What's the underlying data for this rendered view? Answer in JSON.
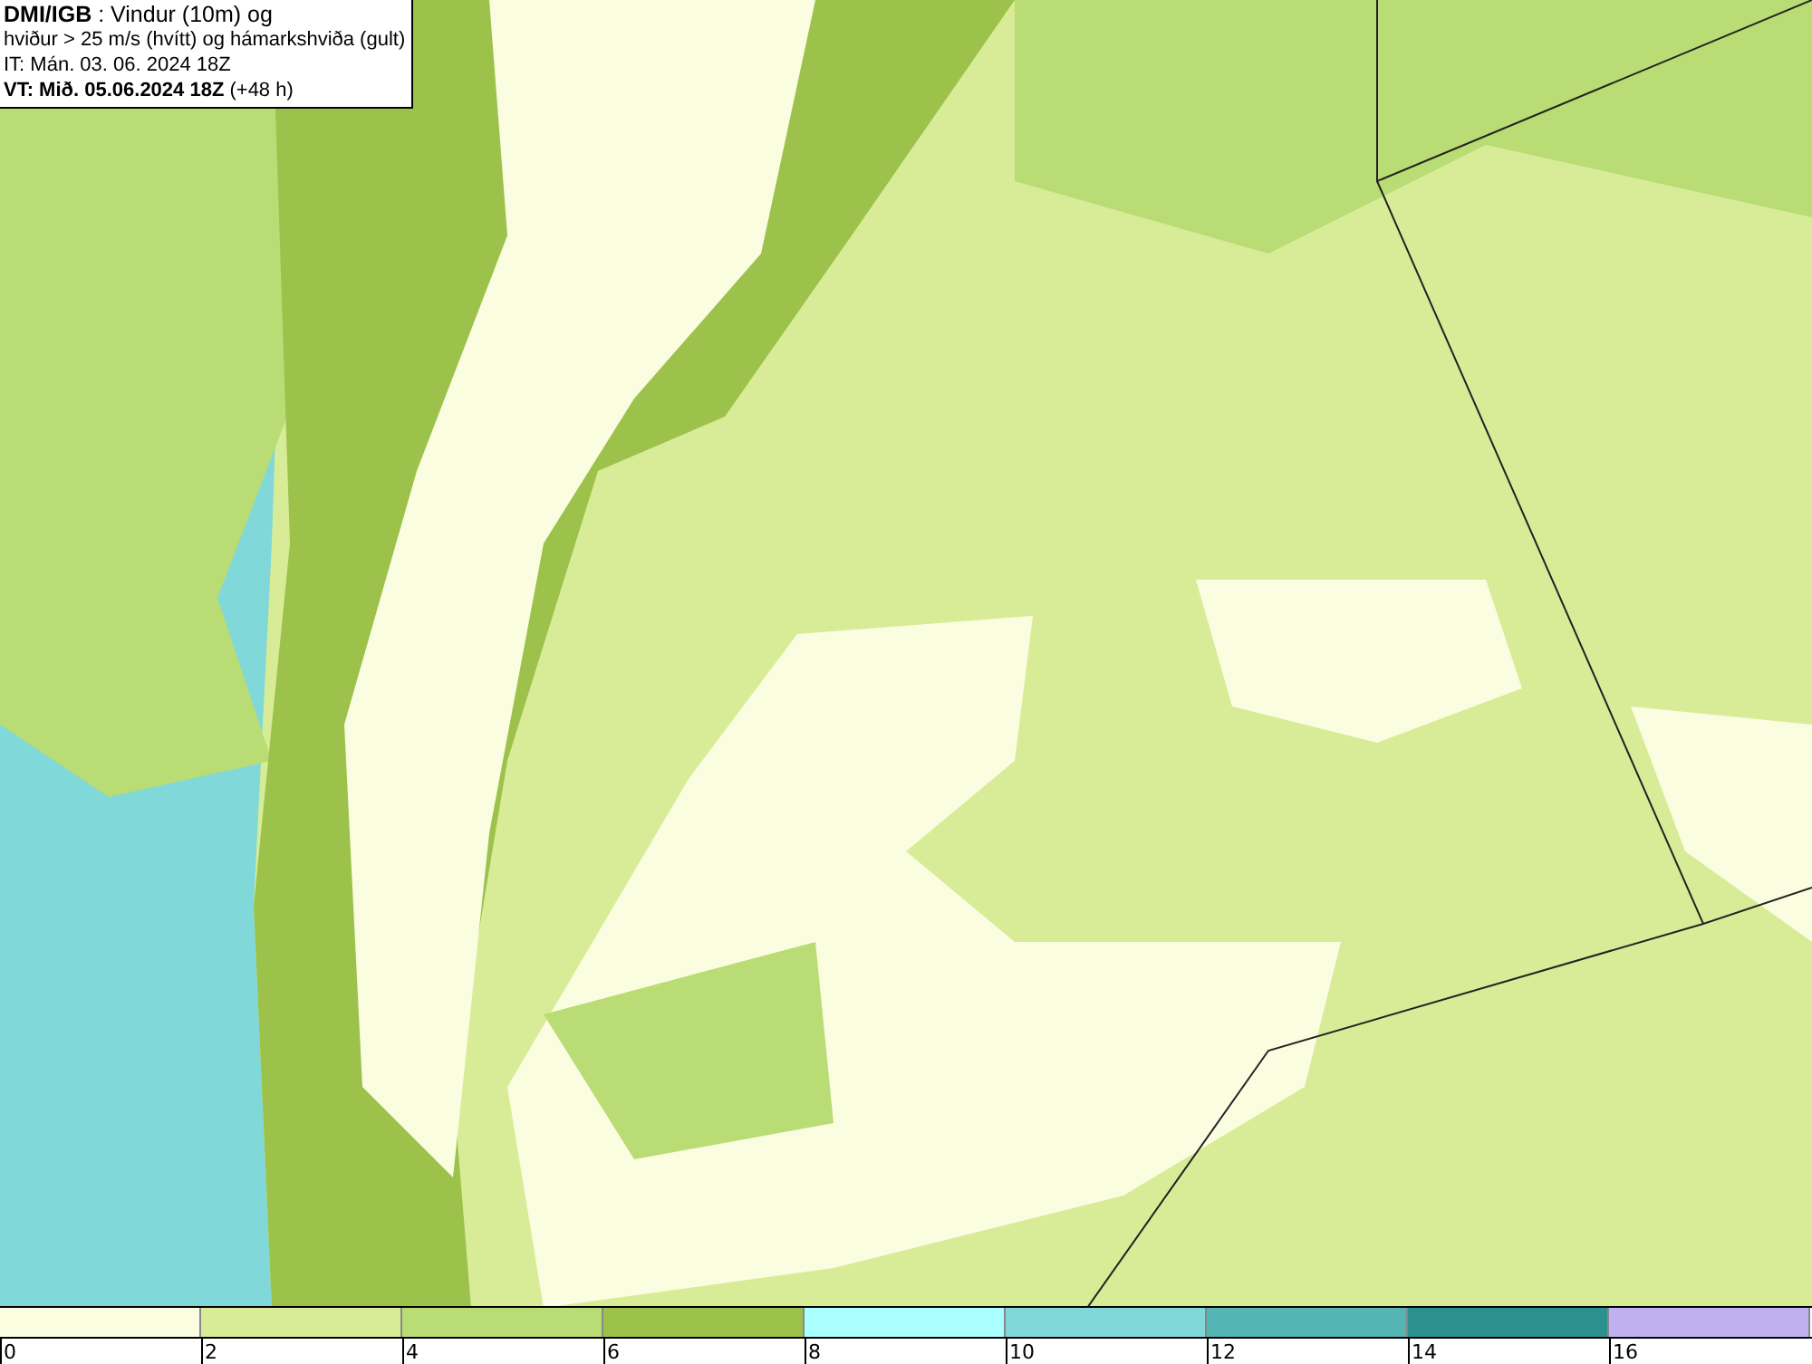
{
  "caption": {
    "lines": [
      "**DMI/IGB** : Vindur (10m) og",
      "hviður > 25 m/s (hvítt) og hámarkshviða (gult)",
      "IT: Mán. 03. 06. 2024 18Z",
      "**VT: Mið. 05.06.2024 18Z** (+48 h)"
    ]
  },
  "colorbar": {
    "bins": [
      {
        "label": "0",
        "color": "#fafde0"
      },
      {
        "label": "2",
        "color": "#d8ec98"
      },
      {
        "label": "4",
        "color": "#b9dc74"
      },
      {
        "label": "6",
        "color": "#9cc24c"
      },
      {
        "label": "8",
        "color": "#aaffff"
      },
      {
        "label": "10",
        "color": "#80d8d8"
      },
      {
        "label": "12",
        "color": "#55b4b4"
      },
      {
        "label": "14",
        "color": "#2a9090"
      },
      {
        "label": "16",
        "color": "#c0b0f0"
      }
    ]
  }
}
